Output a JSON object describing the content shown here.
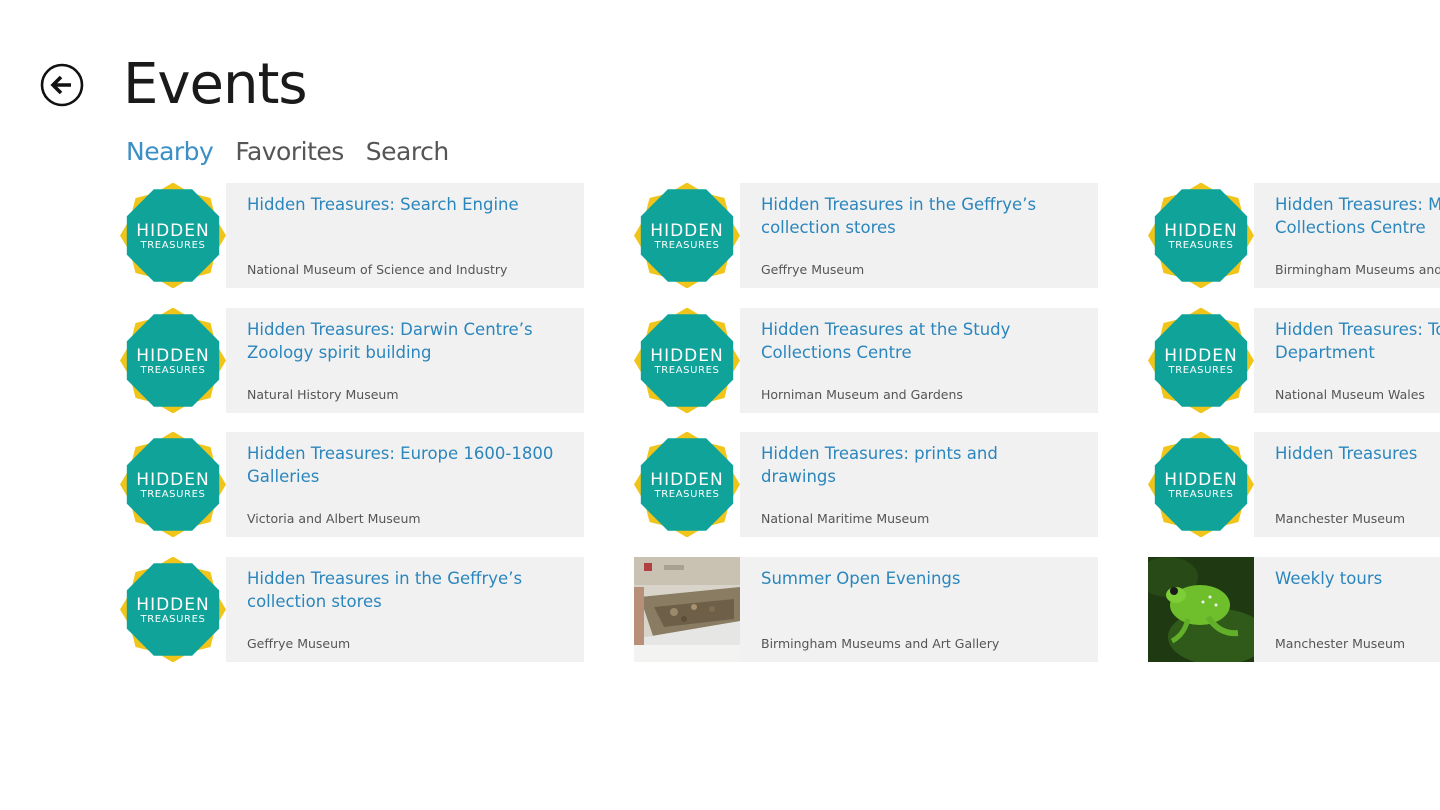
{
  "header": {
    "title": "Events",
    "back_icon": "back-arrow-circle-icon"
  },
  "tabs": [
    {
      "label": "Nearby",
      "active": true
    },
    {
      "label": "Favorites",
      "active": false
    },
    {
      "label": "Search",
      "active": false
    }
  ],
  "logo": {
    "line1": "HIDDEN",
    "line2": "TREASURES",
    "colors": {
      "teal": "#0fa39a",
      "yellow": "#f0c419",
      "text": "#ffffff"
    }
  },
  "colors": {
    "accent": "#3a8fc4",
    "tile_title": "#2a86bd",
    "tile_background": "#f1f1f1"
  },
  "events": [
    {
      "title": "Hidden Treasures: Search Engine",
      "venue": "National Museum of Science and Industry",
      "image": "hidden-treasures-logo"
    },
    {
      "title": "Hidden Treasures: Darwin Centre’s Zoology spirit building",
      "venue": "Natural History Museum",
      "image": "hidden-treasures-logo"
    },
    {
      "title": "Hidden Treasures: Europe 1600-1800 Galleries",
      "venue": "Victoria and Albert Museum",
      "image": "hidden-treasures-logo"
    },
    {
      "title": "Hidden Treasures in the Geffrye’s collection stores",
      "venue": "Geffrye Museum",
      "image": "hidden-treasures-logo"
    },
    {
      "title": "Hidden Treasures in the Geffrye’s collection stores",
      "venue": "Geffrye Museum",
      "image": "hidden-treasures-logo"
    },
    {
      "title": "Hidden Treasures at the Study Collections Centre",
      "venue": "Horniman Museum and Gardens",
      "image": "hidden-treasures-logo"
    },
    {
      "title": "Hidden Treasures: prints and drawings",
      "venue": "National Maritime Museum",
      "image": "hidden-treasures-logo"
    },
    {
      "title": "Summer Open Evenings",
      "venue": "Birmingham Museums and Art Gallery",
      "image": "museum-display-photo"
    },
    {
      "title": "Hidden Treasures: Museum Collections Centre",
      "venue": "Birmingham Museums and Art Gallery",
      "image": "hidden-treasures-logo"
    },
    {
      "title": "Hidden Treasures: Tour of the Department",
      "venue": "National Museum Wales",
      "image": "hidden-treasures-logo"
    },
    {
      "title": "Hidden Treasures",
      "venue": "Manchester Museum",
      "image": "hidden-treasures-logo"
    },
    {
      "title": "Weekly tours",
      "venue": "Manchester Museum",
      "image": "green-frog-photo"
    }
  ]
}
